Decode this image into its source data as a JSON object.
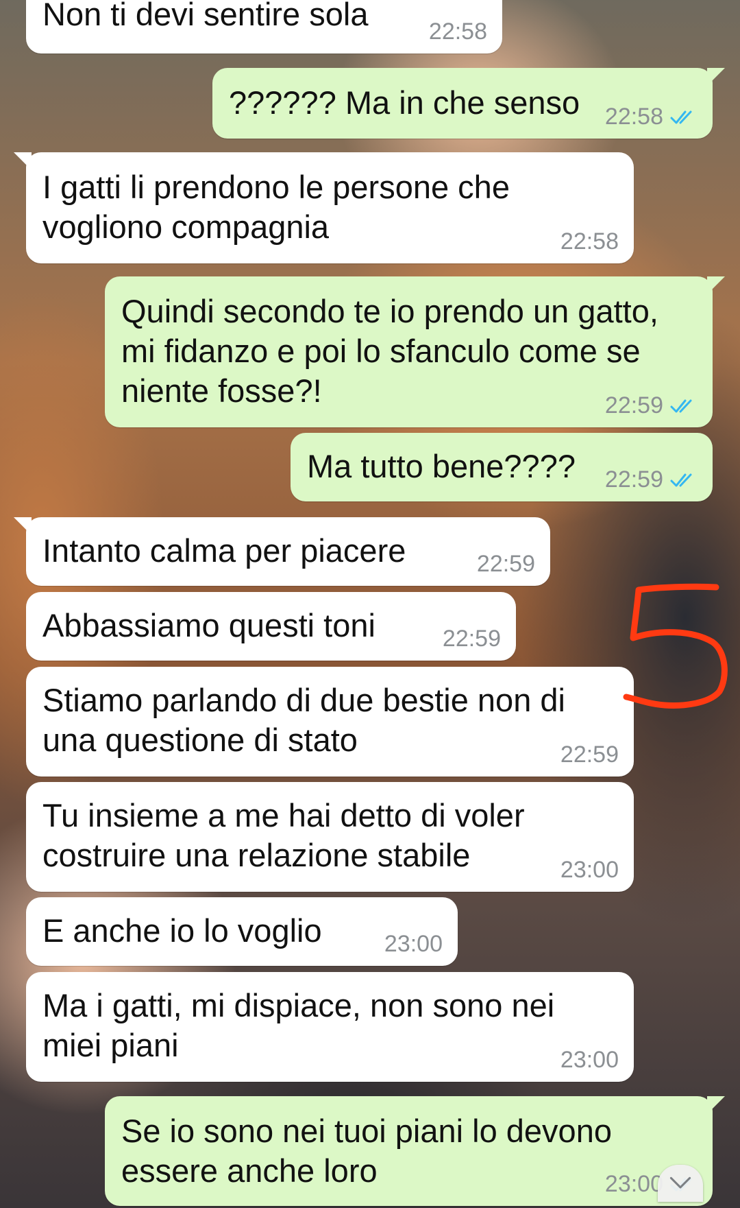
{
  "messages": [
    {
      "id": "m1",
      "direction": "in",
      "text": "Non ti devi sentire sola",
      "time": "22:58"
    },
    {
      "id": "m2",
      "direction": "out",
      "text": "?????? Ma in che senso",
      "time": "22:58",
      "status": "read"
    },
    {
      "id": "m3",
      "direction": "in",
      "text": "I gatti li prendono le persone che\nvogliono compagnia",
      "time": "22:58"
    },
    {
      "id": "m4",
      "direction": "out",
      "text": "Quindi secondo te io prendo un gatto,\nmi fidanzo e poi lo sfanculo come se\nniente fosse?!",
      "time": "22:59",
      "status": "read"
    },
    {
      "id": "m5",
      "direction": "out",
      "text": "Ma tutto bene????",
      "time": "22:59",
      "status": "read"
    },
    {
      "id": "m6",
      "direction": "in",
      "text": "Intanto calma per piacere",
      "time": "22:59"
    },
    {
      "id": "m7",
      "direction": "in",
      "text": "Abbassiamo questi toni",
      "time": "22:59"
    },
    {
      "id": "m8",
      "direction": "in",
      "text": "Stiamo parlando di due bestie non di\nuna questione di stato",
      "time": "22:59"
    },
    {
      "id": "m9",
      "direction": "in",
      "text": "Tu insieme a me hai detto di voler\ncostruire una relazione stabile",
      "time": "23:00"
    },
    {
      "id": "m10",
      "direction": "in",
      "text": "E anche io lo voglio",
      "time": "23:00"
    },
    {
      "id": "m11",
      "direction": "in",
      "text": "Ma i gatti, mi dispiace, non sono nei\nmiei piani",
      "time": "23:00"
    },
    {
      "id": "m12",
      "direction": "out",
      "text": "Se io sono nei tuoi piani lo devono\nessere anche loro",
      "time": "23:00",
      "status": "read"
    }
  ],
  "annotation": {
    "text": "5",
    "color": "#ff3a12"
  },
  "colors": {
    "incoming": "#ffffff",
    "outgoing": "#dcf8c6",
    "read_ticks": "#34b7f1",
    "timestamp": "#8b8f93"
  },
  "icons": {
    "read_receipt": "double-check-icon",
    "scroll_down": "chevron-down-icon"
  }
}
